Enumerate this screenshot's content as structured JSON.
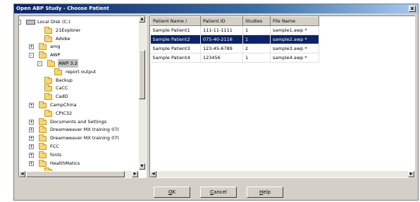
{
  "window": {
    "title": "Open ABP Study - Choose Patient",
    "close_label": "x"
  },
  "tree": {
    "items": [
      {
        "label": "Local Disk (C:)",
        "icon": "disk-icon",
        "expander": "-"
      },
      {
        "label": "21Explorer",
        "icon": "folder-icon",
        "expander": ""
      },
      {
        "label": "Adobe",
        "icon": "folder-icon",
        "expander": ""
      },
      {
        "label": "amg",
        "icon": "folder-icon",
        "expander": "+"
      },
      {
        "label": "AWP",
        "icon": "folder-icon",
        "expander": "-"
      },
      {
        "label": "AWP 3.2",
        "icon": "open-folder-icon",
        "expander": "-"
      },
      {
        "label": "report output",
        "icon": "folder-icon",
        "expander": ""
      },
      {
        "label": "Backup",
        "icon": "folder-icon",
        "expander": ""
      },
      {
        "label": "CaCC",
        "icon": "folder-icon",
        "expander": ""
      },
      {
        "label": "CadD",
        "icon": "folder-icon",
        "expander": ""
      },
      {
        "label": "CampChina",
        "icon": "folder-icon",
        "expander": "+"
      },
      {
        "label": "CPIC32",
        "icon": "folder-icon",
        "expander": ""
      },
      {
        "label": "Documents and Settings",
        "icon": "folder-icon",
        "expander": "+"
      },
      {
        "label": "Dreamweaver MX training 07(",
        "icon": "folder-icon",
        "expander": "+"
      },
      {
        "label": "Dreamweaver MX training 07(",
        "icon": "folder-icon",
        "expander": "+"
      },
      {
        "label": "FCC",
        "icon": "folder-icon",
        "expander": "+"
      },
      {
        "label": "fonts",
        "icon": "folder-icon",
        "expander": "+"
      },
      {
        "label": "HealthMatics",
        "icon": "folder-icon",
        "expander": "+"
      },
      {
        "label": "",
        "icon": "folder-icon",
        "expander": ""
      }
    ]
  },
  "patients": {
    "columns": [
      "Patient Name /",
      "Patient ID",
      "Studies",
      "File Name"
    ],
    "rows": [
      {
        "name": "Sample Patient1",
        "id": "111-11-1111",
        "studies": "1",
        "file": "sample1.awp *"
      },
      {
        "name": "Sample Patient2",
        "id": "075-40-2116",
        "studies": "1",
        "file": "sample2.awp *"
      },
      {
        "name": "Sample Patient3",
        "id": "123-45-6789",
        "studies": "2",
        "file": "sample3.awp *"
      },
      {
        "name": "Sample Patient4",
        "id": "123456",
        "studies": "1",
        "file": "sample4.awp *"
      }
    ],
    "selected_row": 1
  },
  "buttons": {
    "ok_key": "O",
    "ok_rest": "K",
    "cancel_key": "C",
    "cancel_rest": "ancel",
    "help_key": "H",
    "help_rest": "elp"
  },
  "scroll_glyphs": {
    "up": "▲",
    "down": "▼",
    "left": "◀",
    "right": "▶"
  },
  "colors": {
    "title_start": "#0a246a",
    "selection": "#0a246a",
    "face": "#d4d0c8"
  }
}
